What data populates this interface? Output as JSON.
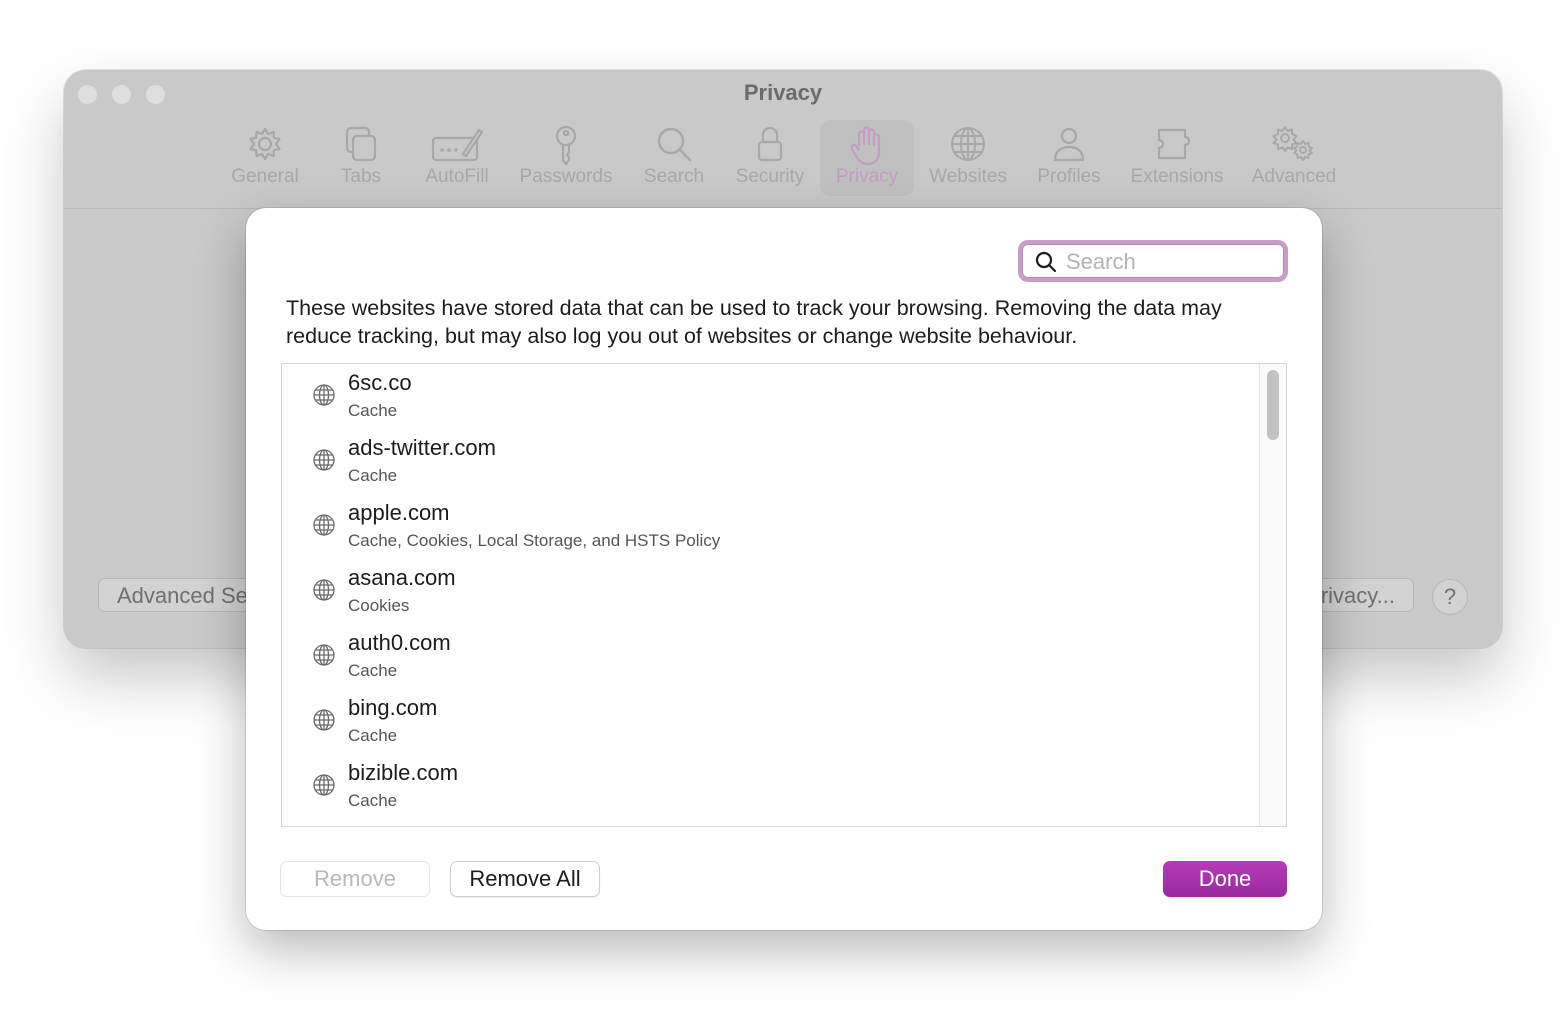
{
  "window": {
    "title": "Privacy",
    "toolbar": [
      {
        "label": "General",
        "icon": "gear-icon"
      },
      {
        "label": "Tabs",
        "icon": "tabs-icon"
      },
      {
        "label": "AutoFill",
        "icon": "autofill-icon"
      },
      {
        "label": "Passwords",
        "icon": "key-icon"
      },
      {
        "label": "Search",
        "icon": "magnifier-icon"
      },
      {
        "label": "Security",
        "icon": "lock-icon"
      },
      {
        "label": "Privacy",
        "icon": "hand-icon",
        "selected": true
      },
      {
        "label": "Websites",
        "icon": "globe-icon"
      },
      {
        "label": "Profiles",
        "icon": "person-icon"
      },
      {
        "label": "Extensions",
        "icon": "puzzle-icon"
      },
      {
        "label": "Advanced",
        "icon": "gears-icon"
      }
    ],
    "bottom_left_button": "Advanced Se",
    "bottom_right_button": "rivacy...",
    "help_button": "?"
  },
  "sheet": {
    "search": {
      "placeholder": "Search",
      "value": ""
    },
    "description": "These websites have stored data that can be used to track your browsing. Removing the data may reduce tracking, but may also log you out of websites or change website behaviour.",
    "websites": [
      {
        "domain": "6sc.co",
        "data_types": "Cache"
      },
      {
        "domain": "ads-twitter.com",
        "data_types": "Cache"
      },
      {
        "domain": "apple.com",
        "data_types": "Cache, Cookies, Local Storage, and HSTS Policy"
      },
      {
        "domain": "asana.com",
        "data_types": "Cookies"
      },
      {
        "domain": "auth0.com",
        "data_types": "Cache"
      },
      {
        "domain": "bing.com",
        "data_types": "Cache"
      },
      {
        "domain": "bizible.com",
        "data_types": "Cache"
      }
    ],
    "buttons": {
      "remove": "Remove",
      "remove_all": "Remove All",
      "done": "Done"
    }
  },
  "colors": {
    "accent": "#a32ca6",
    "accent_gradient_top": "#b53bb8",
    "accent_gradient_bottom": "#9a2a9d",
    "search_focus_ring": "#c89ec8",
    "toolbar_selected_tint": "#c59ac4"
  }
}
